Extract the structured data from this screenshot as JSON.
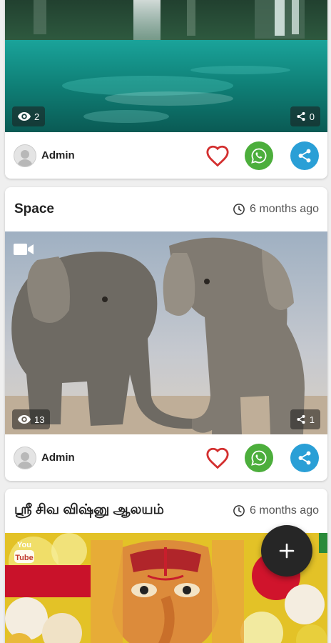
{
  "posts": [
    {
      "title": "",
      "time": "",
      "views": "2",
      "shares": "0",
      "author": "Admin"
    },
    {
      "title": "Space",
      "time": "6 months ago",
      "views": "13",
      "shares": "1",
      "author": "Admin"
    },
    {
      "title": "ஸ்ரீ சிவ விஷ்னு ஆலயம்",
      "time": "6 months ago",
      "youtube_badge": "YouTube"
    }
  ],
  "colors": {
    "like": "#d32f2f",
    "whatsapp": "#4cae3c",
    "share": "#2a9fd6",
    "fab": "#262626"
  },
  "icons": {
    "views": "eye-icon",
    "shares": "share-icon",
    "time": "clock-icon",
    "video": "video-camera-icon",
    "like": "heart-outline-icon",
    "whatsapp": "whatsapp-icon",
    "fab": "plus-icon"
  }
}
